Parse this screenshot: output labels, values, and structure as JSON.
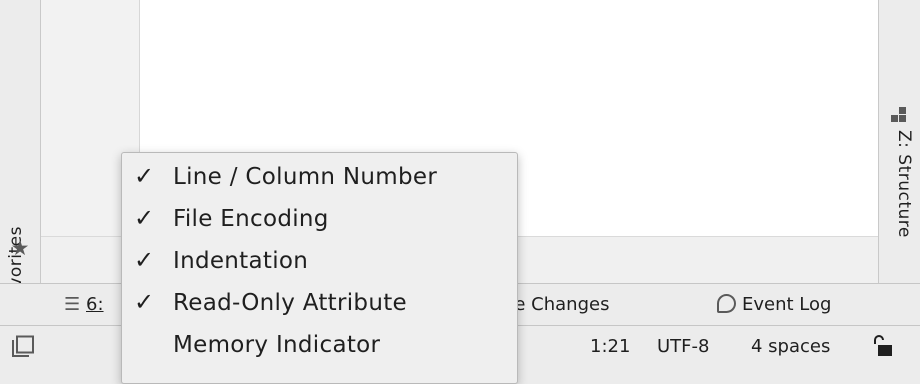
{
  "left_stripe": {
    "favorites": {
      "label": "Favorites",
      "icon": "star-icon"
    }
  },
  "right_stripe": {
    "structure": {
      "label": "Z: Structure",
      "icon": "structure-icon"
    }
  },
  "tool_windows": {
    "todo": {
      "number": "6:",
      "icon": "list-icon"
    },
    "changes": {
      "label": "se Changes"
    },
    "event_log": {
      "label": "Event Log",
      "icon": "event-log-icon"
    }
  },
  "status_bar": {
    "position": "1:21",
    "encoding": "UTF-8",
    "indent": "4 spaces",
    "toggle_icon": "tool-window-toggle-icon",
    "lock_icon": "unlock-icon"
  },
  "popup_menu": {
    "items": [
      {
        "label": "Line / Column Number",
        "checked": true
      },
      {
        "label": "File Encoding",
        "checked": true
      },
      {
        "label": "Indentation",
        "checked": true
      },
      {
        "label": "Read-Only Attribute",
        "checked": true
      },
      {
        "label": "Memory Indicator",
        "checked": false
      }
    ],
    "check_glyph": "✓"
  }
}
